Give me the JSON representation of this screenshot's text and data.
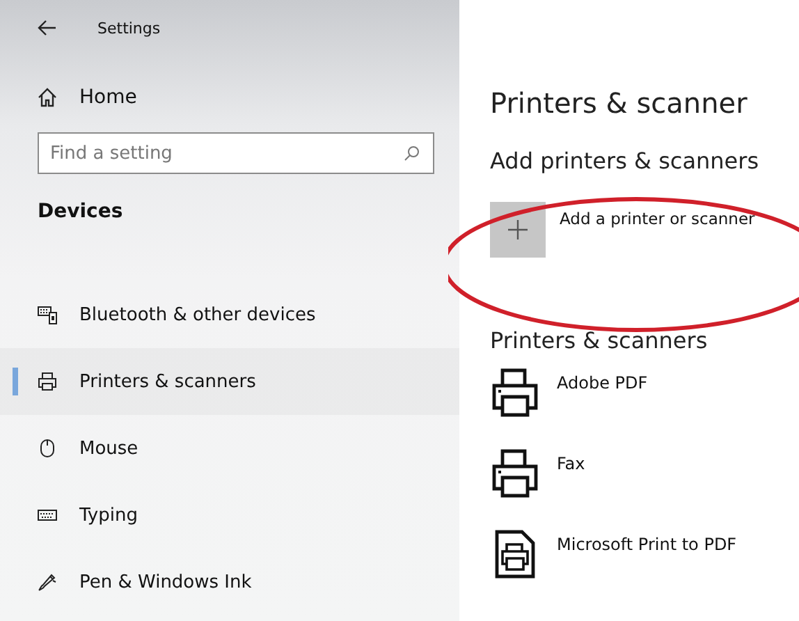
{
  "window": {
    "title": "Settings"
  },
  "sidebar": {
    "home": "Home",
    "search": {
      "placeholder": "Find a setting"
    },
    "section": "Devices",
    "items": [
      {
        "label": "Bluetooth & other devices",
        "kind": "devices",
        "selected": false
      },
      {
        "label": "Printers & scanners",
        "kind": "printer",
        "selected": true
      },
      {
        "label": "Mouse",
        "kind": "mouse",
        "selected": false
      },
      {
        "label": "Typing",
        "kind": "keyboard",
        "selected": false
      },
      {
        "label": "Pen & Windows Ink",
        "kind": "pen",
        "selected": false
      }
    ]
  },
  "main": {
    "title": "Printers & scanner",
    "add_heading": "Add printers & scanners",
    "add_button": "Add a printer or scanner",
    "list_heading": "Printers & scanners",
    "printers": [
      {
        "name": "Adobe PDF",
        "kind": "printer"
      },
      {
        "name": "Fax",
        "kind": "printer"
      },
      {
        "name": "Microsoft Print to PDF",
        "kind": "document"
      }
    ]
  }
}
